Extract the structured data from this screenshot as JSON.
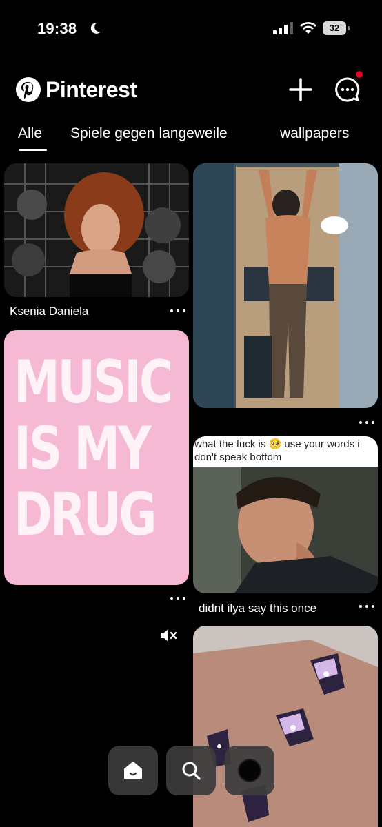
{
  "status_bar": {
    "time": "19:38",
    "battery": "32",
    "icons": [
      "moon-icon",
      "signal-icon",
      "wifi-icon",
      "battery-icon"
    ]
  },
  "header": {
    "app_name": "Pinterest",
    "brand_color": "#e60023",
    "actions": [
      "plus-icon",
      "messages-icon"
    ]
  },
  "tabs": [
    {
      "label": "Alle",
      "selected": true
    },
    {
      "label": "Spiele gegen langeweile",
      "selected": false
    },
    {
      "label": "wallpapers",
      "selected": false
    }
  ],
  "pins": {
    "pin1": {
      "caption": "Ksenia Daniela"
    },
    "pin2": {
      "caption": ""
    },
    "pin3": {
      "text": [
        "MUSIC",
        "IS MY",
        "DRUG"
      ],
      "background": "#f6b9d3"
    },
    "pin4": {
      "meme_line_1": "what the fuck is 🥺 use your words i",
      "meme_line_2": "don't speak bottom",
      "caption": "didnt ilya say this once"
    },
    "pin5": {
      "muted": true
    }
  },
  "bottom_nav": [
    {
      "name": "home",
      "icon": "home-icon",
      "active": true
    },
    {
      "name": "search",
      "icon": "search-icon",
      "active": false
    },
    {
      "name": "profile",
      "icon": "profile-avatar",
      "active": false
    }
  ]
}
